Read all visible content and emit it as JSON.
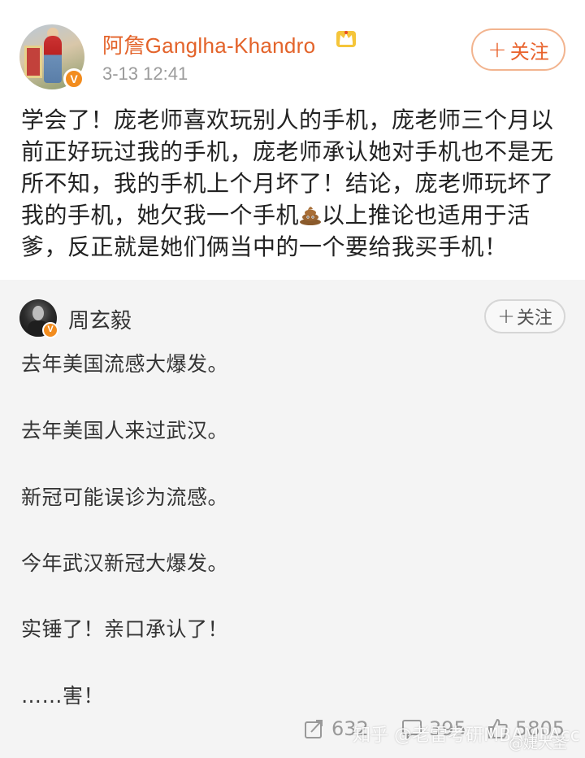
{
  "post": {
    "username": "阿詹Ganglha-Khandro",
    "time": "3-13 12:41",
    "follow_label": "关注",
    "follow_plus": "+",
    "text_part1": "学会了！庞老师喜欢玩别人的手机，庞老师三个月以前正好玩过我的手机，庞老师承认她对手机也不是无所不知，我的手机上个月坏了！结论，庞老师玩坏了我的手机，她欠我一个手机",
    "text_part2": "以上推论也适用于活爹，反正就是她们俩当中的一个要给我买手机！",
    "emoji_icon": "poop-emoji",
    "badge_icon": "crown-icon",
    "verified_mark": "V"
  },
  "retweet": {
    "username": "周玄毅",
    "follow_label": "关注",
    "follow_plus": "+",
    "verified_mark": "V",
    "lines": [
      "去年美国流感大爆发。",
      "去年美国人来过武汉。",
      "新冠可能误诊为流感。",
      "今年武汉新冠大爆发。",
      "实锤了！亲口承认了！",
      "……害！"
    ]
  },
  "actions": {
    "repost_count": "632",
    "comment_count": "395",
    "like_count": "5805"
  },
  "watermarks": {
    "zhihu": "知乎 @老雷考研MBAMPAcc",
    "weibo": "@婕大圣"
  },
  "colors": {
    "username_orange": "#e3632a",
    "verified_orange": "#f28c1e",
    "retweet_bg": "#f4f4f4",
    "muted_gray": "#999999"
  }
}
